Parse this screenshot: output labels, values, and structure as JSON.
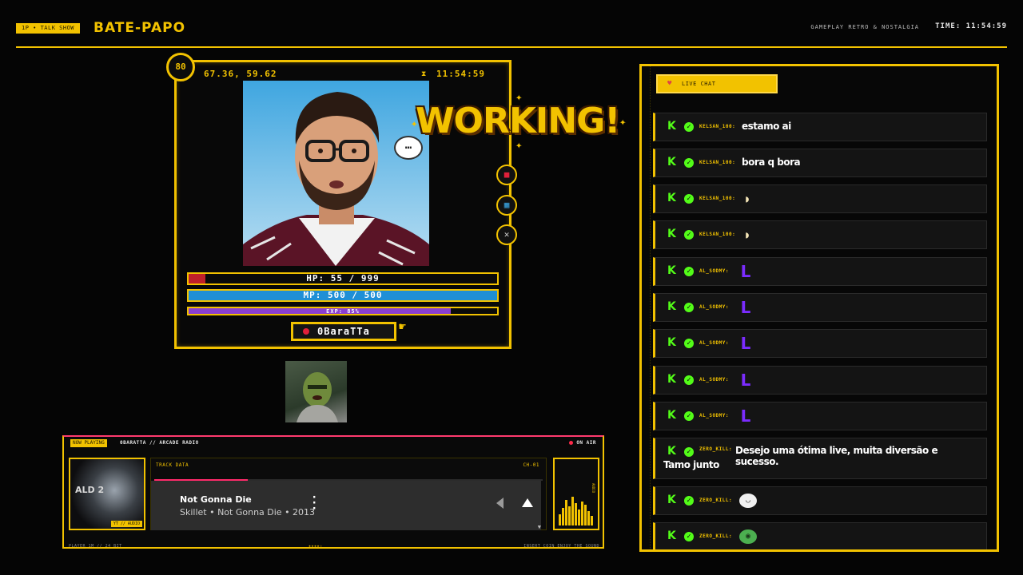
{
  "header": {
    "badge": "1P • TALK SHOW",
    "title": "BATE-PAPO",
    "subtitle": "GAMEPLAY RETRO & NOSTALGIA",
    "clock": "TIME: 11:54:59"
  },
  "player": {
    "level": "80",
    "coords": "67.36, 59.62",
    "time": "11:54:59",
    "banner": "WORKING!",
    "speech": "…",
    "hp": {
      "label": "HP: 55 / 999",
      "fraction": 0.055,
      "color": "#c0202a"
    },
    "mp": {
      "label": "MP: 500 / 500",
      "fraction": 1.0,
      "color": "#1f8fd6"
    },
    "exp": {
      "label": "EXP: 85%",
      "fraction": 0.85,
      "color": "#8a3fd0"
    },
    "name": "0BaraTTa",
    "side_buttons": [
      "lock-icon",
      "map-icon",
      "close-icon"
    ]
  },
  "radio": {
    "badge": "NOW PLAYING",
    "station": "0BARATTA // ARCADE RADIO",
    "status": "ON AIR",
    "album_title": "ALD 2",
    "album_tag": "YT // AUDIO",
    "track_label": "TRACK DATA",
    "channel": "CH-01",
    "progress": 0.24,
    "song_title": "Not Gonna Die",
    "song_meta": "Skillet • Not Gonna Die • 2013",
    "eq_label": "AUDIO",
    "footer_left": "PLAYER_1M // 24 BIT",
    "footer_mid": "★★★★☆",
    "footer_right": "INSERT COIN    ENJOY THE SOUND",
    "eq_levels": [
      0.35,
      0.55,
      0.8,
      0.6,
      0.9,
      0.7,
      0.5,
      0.75,
      0.65,
      0.45,
      0.3
    ]
  },
  "chat": {
    "tab_label": "LIVE CHAT",
    "messages": [
      {
        "user": "KELSAN_100:",
        "text": "estamo ai",
        "emote": ""
      },
      {
        "user": "KELSAN_100:",
        "text": "bora q bora",
        "emote": ""
      },
      {
        "user": "KELSAN_100:",
        "text": "",
        "emote": "bread"
      },
      {
        "user": "KELSAN_100:",
        "text": "",
        "emote": "bread"
      },
      {
        "user": "AL_SODMY:",
        "text": "",
        "emote": "L"
      },
      {
        "user": "AL_SODMY:",
        "text": "",
        "emote": "L"
      },
      {
        "user": "AL_SODMY:",
        "text": "",
        "emote": "L"
      },
      {
        "user": "AL_SODMY:",
        "text": "",
        "emote": "L"
      },
      {
        "user": "AL_SODMY:",
        "text": "",
        "emote": "L"
      },
      {
        "user": "ZERO_KILL:",
        "text": "Desejo uma ótima live, muita diversão e sucesso.",
        "text2": "Tamo junto",
        "emote": ""
      },
      {
        "user": "ZERO_KILL:",
        "text": "",
        "emote": "face"
      },
      {
        "user": "ZERO_KILL:",
        "text": "",
        "emote": "frog"
      }
    ]
  }
}
